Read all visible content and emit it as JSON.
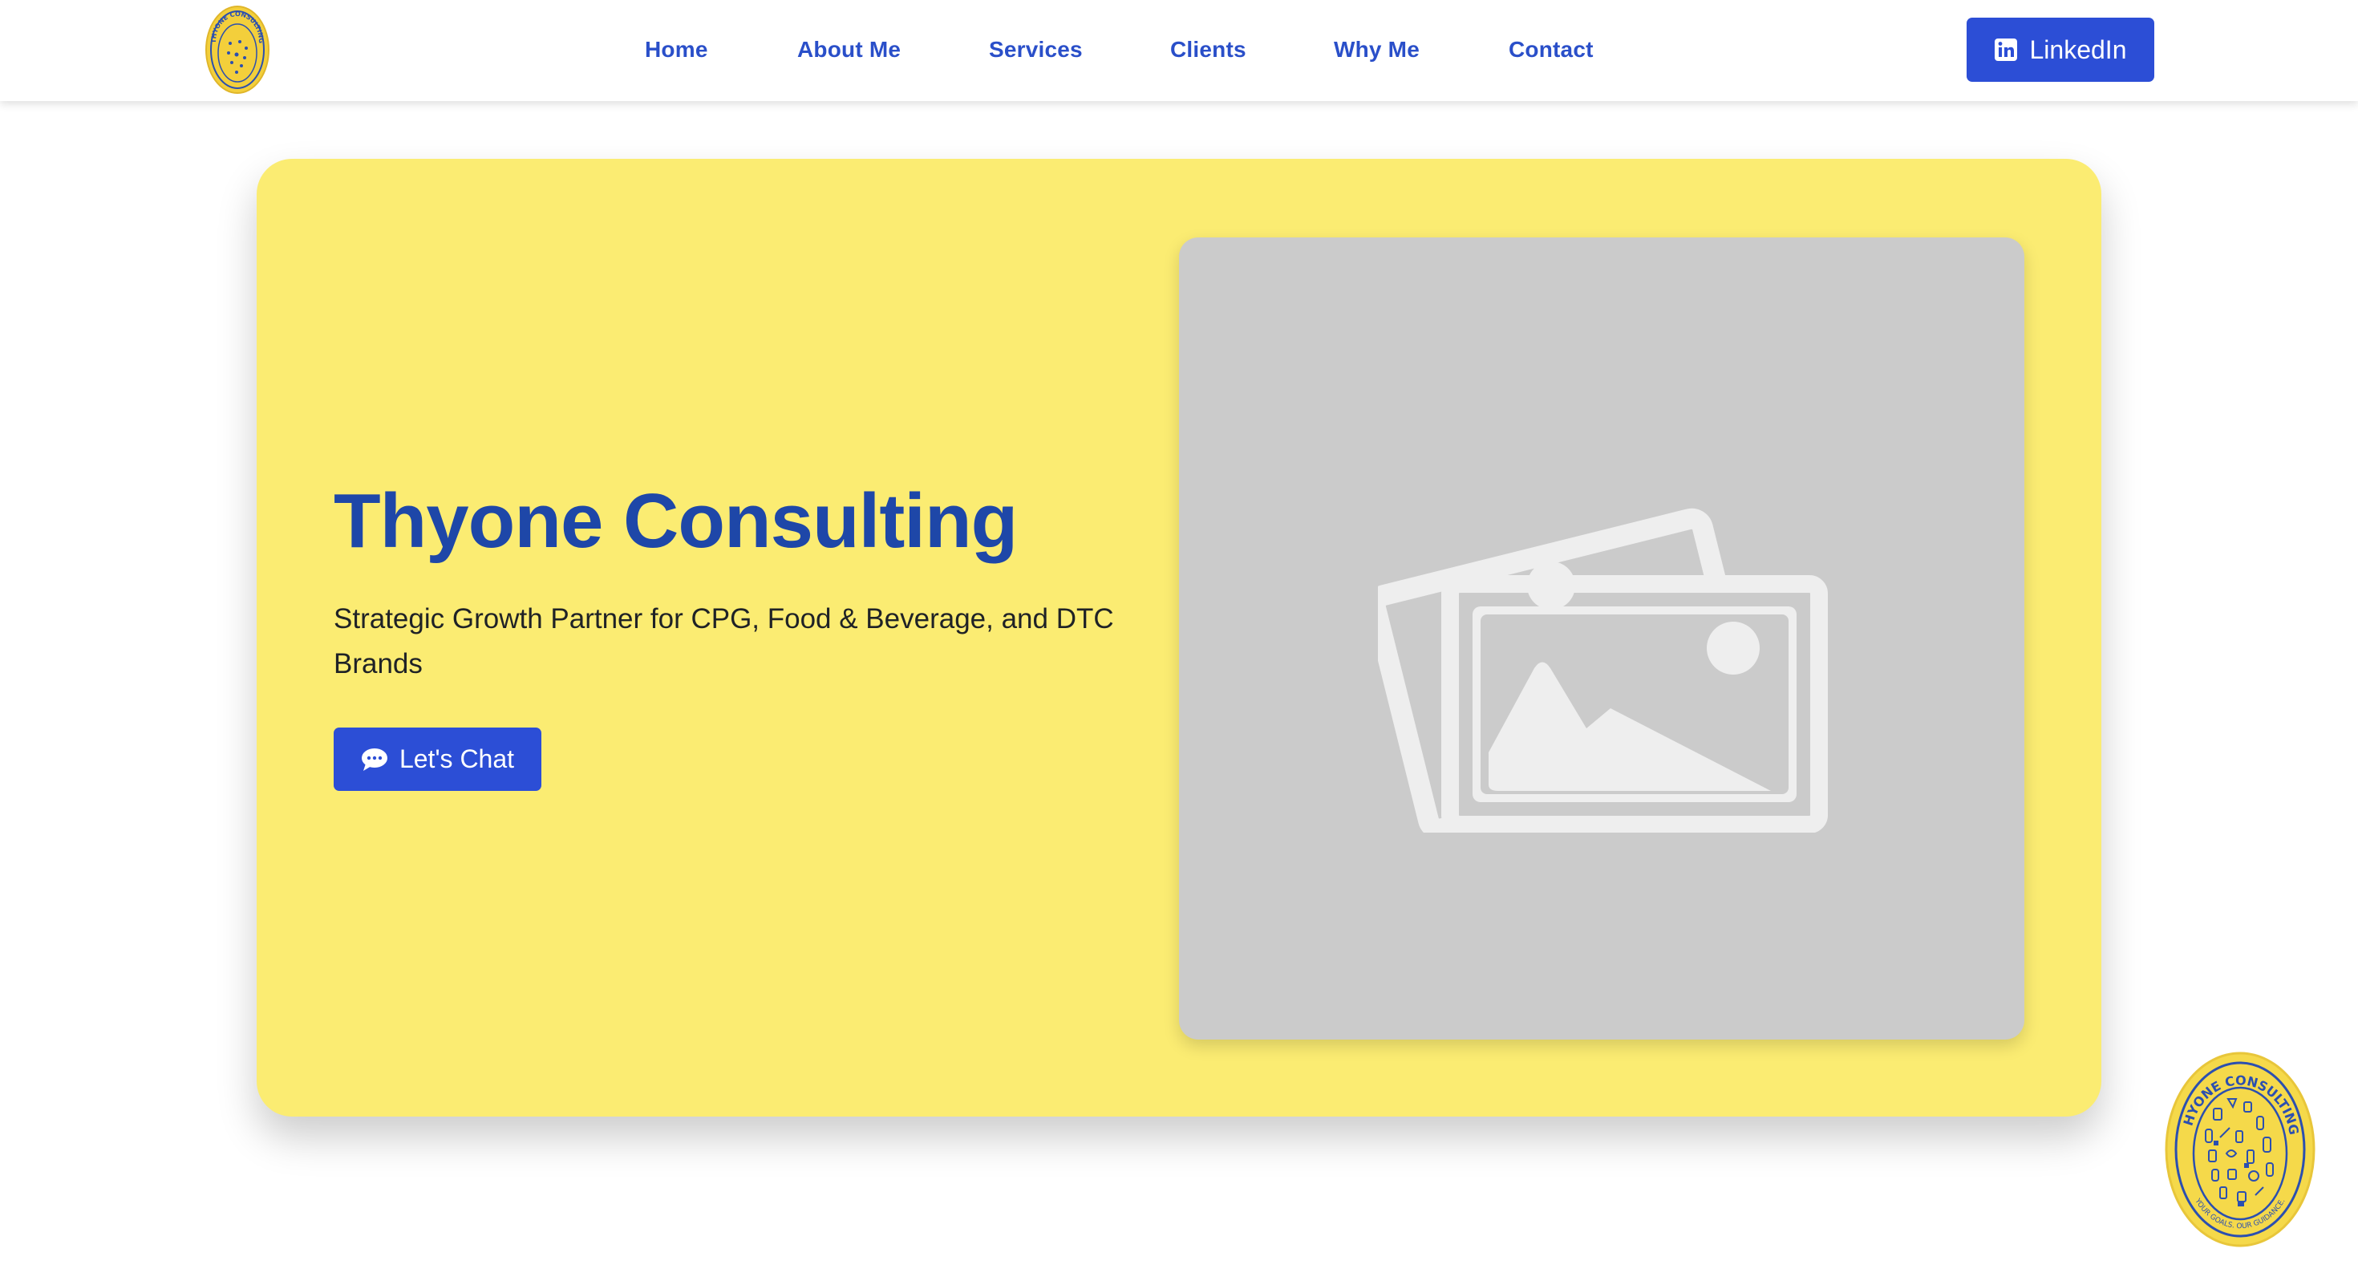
{
  "nav": {
    "logo_icon": "thyone-consulting-badge-icon",
    "links": [
      {
        "label": "Home"
      },
      {
        "label": "About Me"
      },
      {
        "label": "Services"
      },
      {
        "label": "Clients"
      },
      {
        "label": "Why Me"
      },
      {
        "label": "Contact"
      }
    ],
    "linkedin": {
      "label": "LinkedIn",
      "icon": "linkedin-icon"
    }
  },
  "hero": {
    "title": "Thyone Consulting",
    "subtitle": "Strategic Growth Partner for CPG, Food & Beverage, and DTC Brands",
    "cta": {
      "label": "Let's Chat",
      "icon": "chat-bubble-icon"
    },
    "image": {
      "icon": "image-placeholder-icon"
    },
    "badge": {
      "top_text": "THYONE CONSULTING",
      "bottom_text": "YOUR GOALS. OUR GUIDANCE."
    }
  },
  "colors": {
    "primary_blue": "#2c4ed6",
    "title_blue": "#1e47a8",
    "hero_yellow": "#fbec72",
    "badge_yellow": "#f5d94a",
    "placeholder_gray": "#cbcbcb"
  }
}
